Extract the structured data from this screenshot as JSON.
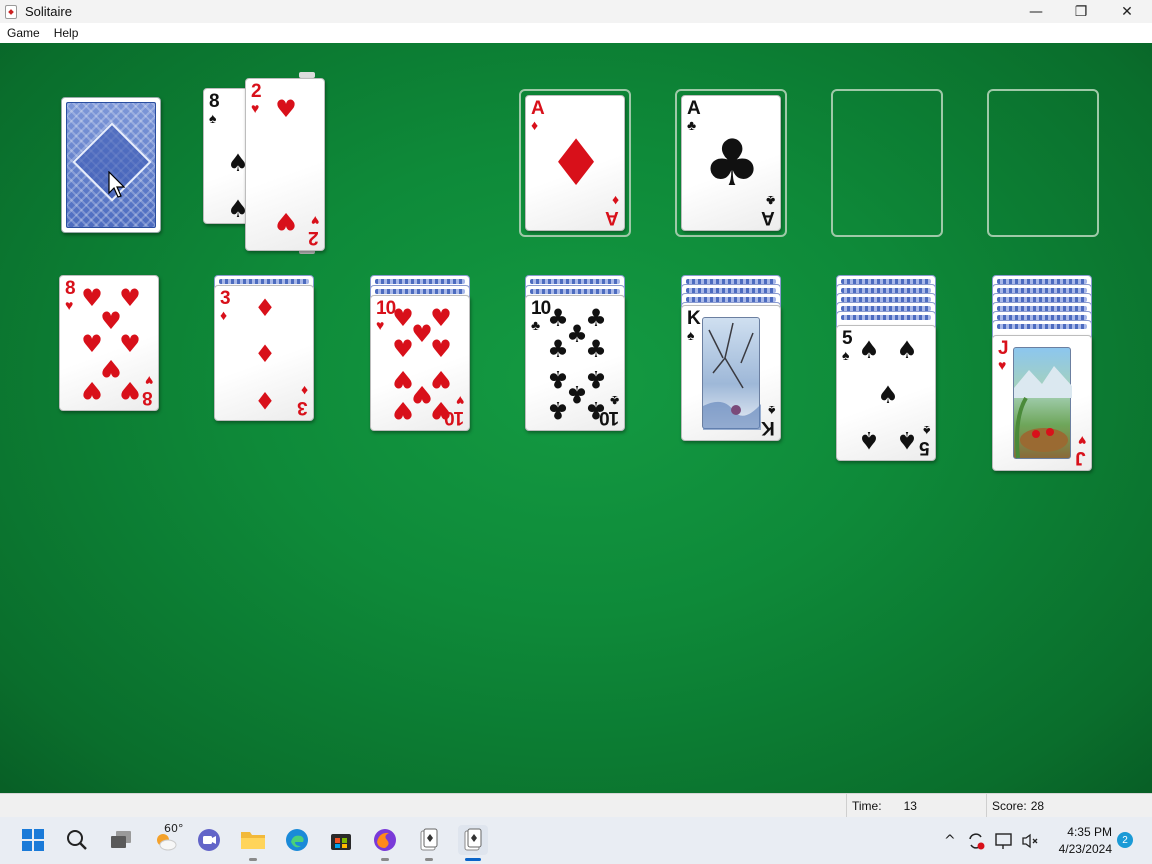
{
  "window": {
    "title": "Solitaire",
    "minimize_glyph": "—",
    "maximize_glyph": "❐",
    "close_glyph": "✕"
  },
  "menu": {
    "items": [
      "Game",
      "Help"
    ]
  },
  "stock": {
    "face_down": true
  },
  "waste": {
    "cards": [
      {
        "rank": "8",
        "suit": "♠",
        "color": "black"
      },
      {
        "rank": "2",
        "suit": "♥",
        "color": "red"
      }
    ]
  },
  "foundations": [
    {
      "rank": "A",
      "suit": "♦",
      "color": "red"
    },
    {
      "rank": "A",
      "suit": "♣",
      "color": "black"
    },
    {
      "empty": true
    },
    {
      "empty": true
    }
  ],
  "tableau": [
    {
      "face_down_count": 0,
      "top": {
        "rank": "8",
        "suit": "♥",
        "color": "red"
      }
    },
    {
      "face_down_count": 1,
      "top": {
        "rank": "3",
        "suit": "♦",
        "color": "red"
      }
    },
    {
      "face_down_count": 2,
      "top": {
        "rank": "10",
        "suit": "♥",
        "color": "red"
      }
    },
    {
      "face_down_count": 3,
      "top": {
        "rank": "10",
        "suit": "♣",
        "color": "black"
      }
    },
    {
      "face_down_count": 4,
      "top": {
        "rank": "K",
        "suit": "♠",
        "color": "black"
      }
    },
    {
      "face_down_count": 5,
      "top": {
        "rank": "5",
        "suit": "♠",
        "color": "black"
      }
    },
    {
      "face_down_count": 6,
      "top": {
        "rank": "J",
        "suit": "♥",
        "color": "red"
      }
    }
  ],
  "status": {
    "time_label": "Time:",
    "time_value": "13",
    "score_label": "Score:",
    "score_value": "28"
  },
  "taskbar": {
    "weather_temp": "60°",
    "clock_time": "4:35 PM",
    "clock_date": "4/23/2024",
    "notification_count": "2",
    "colors": {
      "accent": "#0a64c8",
      "felt": "#0e8a39"
    }
  }
}
